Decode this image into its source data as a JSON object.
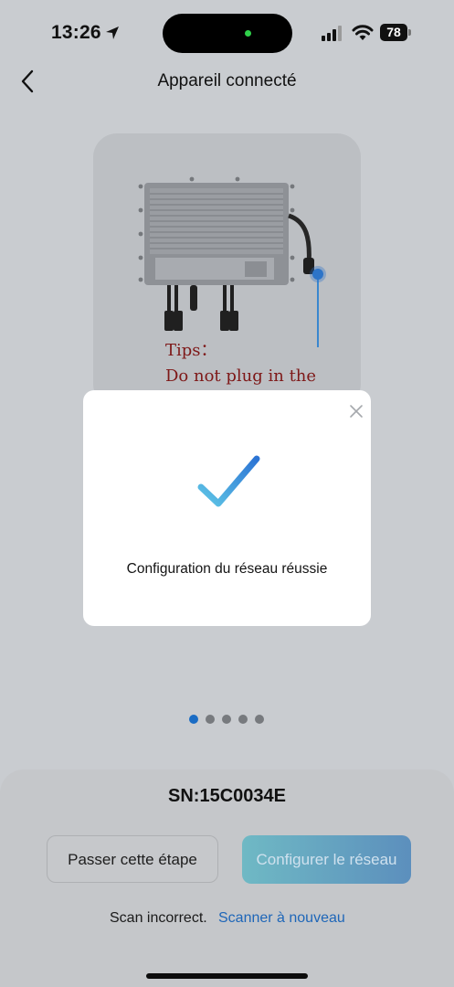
{
  "status_bar": {
    "time": "13:26",
    "battery": "78"
  },
  "header": {
    "title": "Appareil connecté"
  },
  "card": {
    "tips_line1": "Tips：",
    "tips_line2": "Do not plug in the"
  },
  "carousel": {
    "total": 5,
    "active_index": 0
  },
  "dialog": {
    "message": "Configuration du réseau réussie"
  },
  "device": {
    "serial": "SN:15C0034E"
  },
  "actions": {
    "skip_label": "Passer cette étape",
    "configure_label": "Configurer le réseau",
    "scan_incorrect": "Scan incorrect.",
    "rescan_label": "Scanner à nouveau"
  },
  "colors": {
    "accent": "#1e66b8",
    "check": "#3a9bde",
    "tips": "#7e1818"
  }
}
